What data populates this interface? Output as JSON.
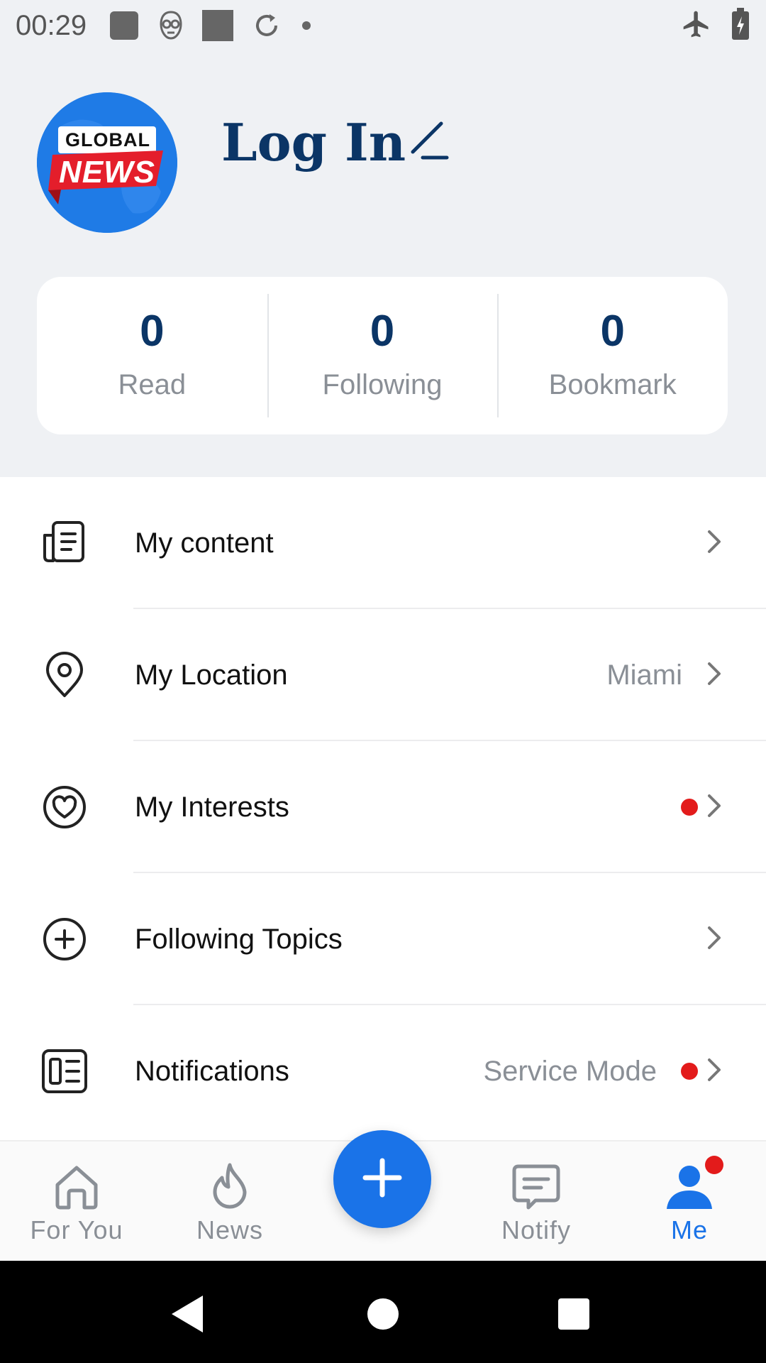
{
  "status_bar": {
    "time": "00:29"
  },
  "profile": {
    "avatar_logo_line1": "GLOBAL",
    "avatar_logo_line2": "NEWS",
    "login_label": "Log In"
  },
  "stats": [
    {
      "value": "0",
      "label": "Read"
    },
    {
      "value": "0",
      "label": "Following"
    },
    {
      "value": "0",
      "label": "Bookmark"
    }
  ],
  "menu": {
    "items": [
      {
        "label": "My content",
        "value": "",
        "icon": "document-icon",
        "dot": false
      },
      {
        "label": "My Location",
        "value": "Miami",
        "icon": "location-pin-icon",
        "dot": false
      },
      {
        "label": "My Interests",
        "value": "",
        "icon": "heart-circle-icon",
        "dot": true
      },
      {
        "label": "Following Topics",
        "value": "",
        "icon": "plus-circle-icon",
        "dot": false
      },
      {
        "label": "Notifications",
        "value": "Service Mode",
        "icon": "notification-card-icon",
        "dot": true
      }
    ]
  },
  "tabbar": {
    "tabs": [
      {
        "label": "For You",
        "icon": "home-icon",
        "active": false
      },
      {
        "label": "News",
        "icon": "flame-icon",
        "active": false
      },
      {
        "label": "Notify",
        "icon": "message-icon",
        "active": false
      },
      {
        "label": "Me",
        "icon": "person-icon",
        "active": true
      }
    ]
  },
  "colors": {
    "accent": "#1a73e8",
    "title": "#0b3566",
    "badge": "#e31b1b",
    "muted": "#8a8f96"
  }
}
